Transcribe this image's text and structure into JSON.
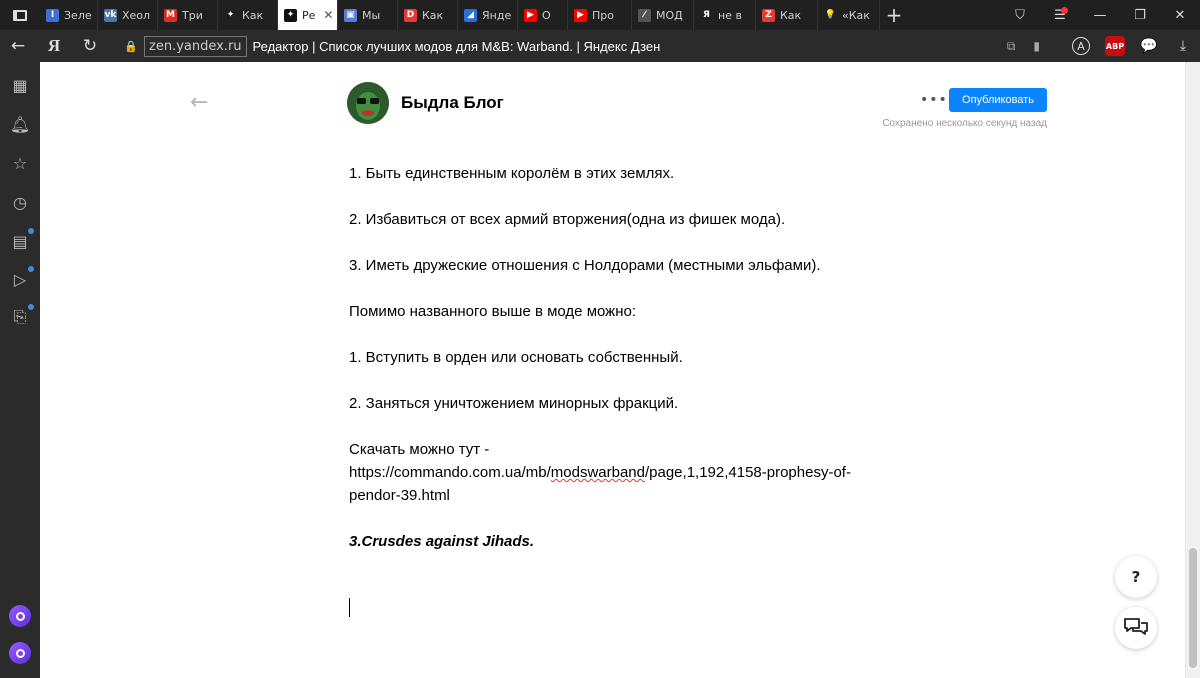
{
  "tabs": [
    {
      "label": "Зеле",
      "fav_text": "I",
      "fav_color": "#3d6fd8"
    },
    {
      "label": "Хеол",
      "fav_text": "vk",
      "fav_color": "#4a76a8"
    },
    {
      "label": "Три",
      "fav_text": "M",
      "fav_color": "#d93025"
    },
    {
      "label": "Как",
      "fav_text": "✦",
      "fav_color": "#202020"
    },
    {
      "label": "Ре",
      "fav_text": "✦",
      "fav_color": "#111111",
      "active": true
    },
    {
      "label": "Мы",
      "fav_text": "▣",
      "fav_color": "#5a7bd8"
    },
    {
      "label": "Как",
      "fav_text": "D",
      "fav_color": "#e53935"
    },
    {
      "label": "Янде",
      "fav_text": "◢",
      "fav_color": "#2a6fdb"
    },
    {
      "label": "О",
      "fav_text": "▶",
      "fav_color": "#ff0000"
    },
    {
      "label": "Про",
      "fav_text": "▶",
      "fav_color": "#ff0000"
    },
    {
      "label": "МОД",
      "fav_text": "⁄",
      "fav_color": "#555555"
    },
    {
      "label": "не в",
      "fav_text": "Я",
      "fav_color": "#202020"
    },
    {
      "label": "Как",
      "fav_text": "Z",
      "fav_color": "#e53935"
    },
    {
      "label": "«Как",
      "fav_text": "💡",
      "fav_color": "#202020"
    }
  ],
  "address": {
    "domain": "zen.yandex.ru",
    "page_title": "Редактор | Список лучших модов для M&B: Warband. | Яндекс Дзен",
    "ya_logo": "Я"
  },
  "editor": {
    "blog_name": "Быдла Блог",
    "publish_label": "Опубликовать",
    "saved_status": "Сохранено несколько секунд назад",
    "more_label": "•••",
    "back_arrow": "←"
  },
  "article": {
    "p1": "1. Быть единственным королём в этих землях.",
    "p2": "2. Избавиться от всех армий вторжения(одна из фишек мода).",
    "p3": "3. Иметь дружеские отношения с Нолдорами (местными эльфами).",
    "p4": "Помимо названного выше в моде можно:",
    "p5": "1. Вступить в орден или основать собственный.",
    "p6": "2. Заняться уничтожением минорных фракций.",
    "p7": "Скачать можно тут -",
    "url_prefix": "https://commando.com.ua/mb/",
    "url_misspelled": "modswarband",
    "url_suffix": "/page,1,192,4158-prophesy-of-pendor-39.html",
    "heading": "3.Crusdes against Jihads."
  },
  "floating": {
    "help_label": "?"
  },
  "colors": {
    "accent": "#0a84ff",
    "sidebar_dot": "#3a8dde",
    "spellcheck": "#e53935"
  }
}
